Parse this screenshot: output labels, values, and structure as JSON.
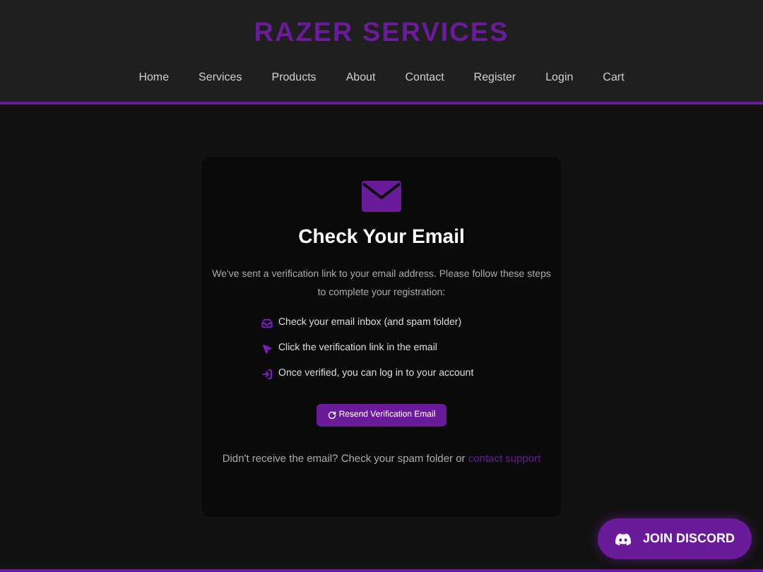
{
  "brand": "RAZER SERVICES",
  "nav": [
    "Home",
    "Services",
    "Products",
    "About",
    "Contact",
    "Register",
    "Login",
    "Cart"
  ],
  "card": {
    "title": "Check Your Email",
    "message": "We've sent a verification link to your email address. Please follow these steps to complete your registration:",
    "steps": [
      {
        "kind": "inbox",
        "text": "Check your email inbox (and spam folder)"
      },
      {
        "kind": "pointer",
        "text": "Click the verification link in the email"
      },
      {
        "kind": "login",
        "text": "Once verified, you can log in to your account"
      }
    ],
    "button": "Resend Verification Email",
    "footer_text": "Didn't receive the email? Check your spam folder or",
    "footer_link": "contact support"
  },
  "discord_button": "JOIN DISCORD"
}
